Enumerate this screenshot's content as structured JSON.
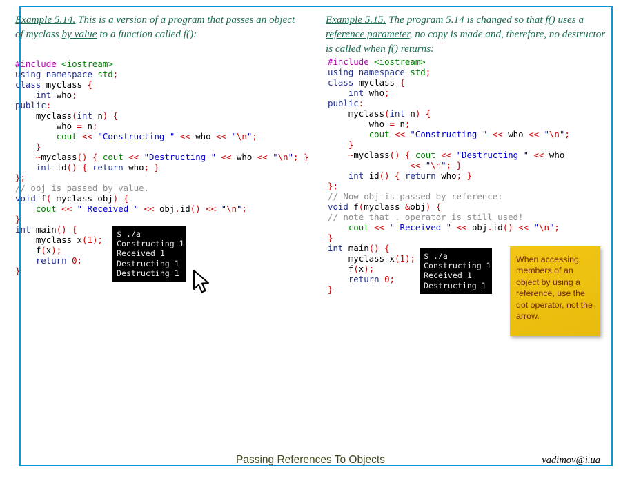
{
  "slide": {
    "border_color": "#0b97d4",
    "background": "#ffffff"
  },
  "left_column": {
    "caption": {
      "label": "Example 5.14.",
      "body_part1": " This is a version of a program that passes an object of myclass ",
      "emphasis": "by value",
      "body_part2": " to a function called f():"
    },
    "code_lines": [
      "#include <iostream>",
      "using namespace std;",
      "class myclass {",
      "    int who;",
      "public:",
      "    myclass(int n) {",
      "        who = n;",
      "        cout << \"Constructing \" << who << \"\\n\";",
      "    }",
      "    ~myclass() { cout << \"Destructing \" << who << \"\\n\"; }",
      "    int id() { return who; }",
      "};",
      "// obj is passed by value.",
      "void f( myclass obj) {",
      "    cout << \" Received \" << obj.id() << \"\\n\";",
      "}",
      "int main() {",
      "    myclass x(1);",
      "    f(x);",
      "    return 0;",
      "}"
    ],
    "terminal": {
      "lines": [
        "$ ./a",
        "Constructing 1",
        "Received 1",
        "Destructing 1",
        "Destructing 1"
      ]
    }
  },
  "right_column": {
    "caption": {
      "label": "Example 5.15.",
      "body_part1": " The program 5.14 is changed so that f() uses a ",
      "emphasis": "reference parameter",
      "body_part2": ", no copy is made and, therefore, no destructor is called when f() returns:"
    },
    "code_lines": [
      "#include <iostream>",
      "using namespace std;",
      "class myclass {",
      "    int who;",
      "public:",
      "    myclass(int n) {",
      "        who = n;",
      "        cout << \"Constructing \" << who << \"\\n\";",
      "    }",
      "    ~myclass() { cout << \"Destructing \" << who",
      "                << \"\\n\"; }",
      "    int id() { return who; }",
      "};",
      "// Now obj is passed by reference:",
      "void f(myclass &obj) {",
      "// note that . operator is still used!",
      "    cout << \" Received \" << obj.id() << \"\\n\";",
      "}",
      "int main() {",
      "    myclass x(1);",
      "    f(x);",
      "    return 0;",
      "}"
    ],
    "terminal": {
      "lines": [
        "$ ./a",
        "Constructing 1",
        "Received 1",
        "Destructing 1"
      ]
    },
    "sticky_note": {
      "text": "When accessing members of an object by using a reference, use the dot operator, not the arrow.",
      "background_color": "#eec211",
      "text_color": "#6d2a12"
    }
  },
  "footer": {
    "title": "Passing References To Objects",
    "author": "vadimov@i.ua",
    "title_color": "#3f4b1e"
  },
  "cursor": {
    "name": "mouse-pointer"
  },
  "syntax_colors": {
    "preprocessor": "#b000b0",
    "include_target": "#008000",
    "keyword": "#1f2f8f",
    "identifier": "#000000",
    "operator": "#cc0000",
    "string": "#0000cc",
    "escape": "#cc0000",
    "comment": "#8c8c8c"
  }
}
